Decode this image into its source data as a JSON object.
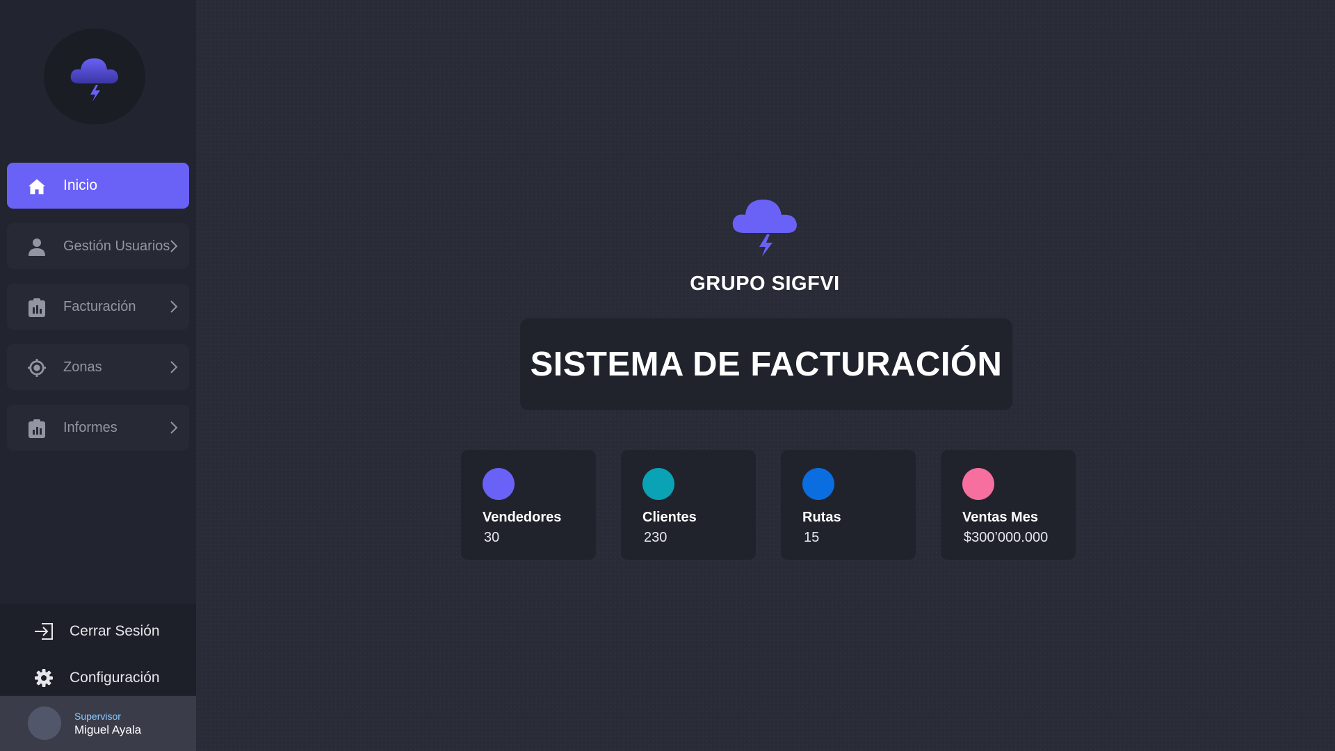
{
  "sidebar": {
    "logo_icon": "cloud-lightning-icon",
    "items": [
      {
        "label": "Inicio",
        "icon": "home-icon",
        "active": true
      },
      {
        "label": "Gestión Usuarios",
        "icon": "user-icon"
      },
      {
        "label": "Facturación",
        "icon": "clipboard-icon"
      },
      {
        "label": "Zonas",
        "icon": "target-icon"
      },
      {
        "label": "Informes",
        "icon": "report-icon"
      }
    ],
    "bottom": {
      "logout": "Cerrar Sesión",
      "settings": "Configuración"
    },
    "user": {
      "role": "Supervisor",
      "name": "Miguel Ayala"
    }
  },
  "main": {
    "brand_name": "GRUPO SIGFVI",
    "title": "SISTEMA DE FACTURACIÓN",
    "stats": [
      {
        "label": "Vendedores",
        "value": "30",
        "color": "#6a61f7"
      },
      {
        "label": "Clientes",
        "value": "230",
        "color": "#0aa3b5"
      },
      {
        "label": "Rutas",
        "value": "15",
        "color": "#0a6de0"
      },
      {
        "label": "Ventas Mes",
        "value": "$300’000.000",
        "color": "#f76f9e"
      }
    ]
  },
  "colors": {
    "accent": "#6a61f7",
    "background": "#292c37",
    "sidebar": "#22252f"
  }
}
